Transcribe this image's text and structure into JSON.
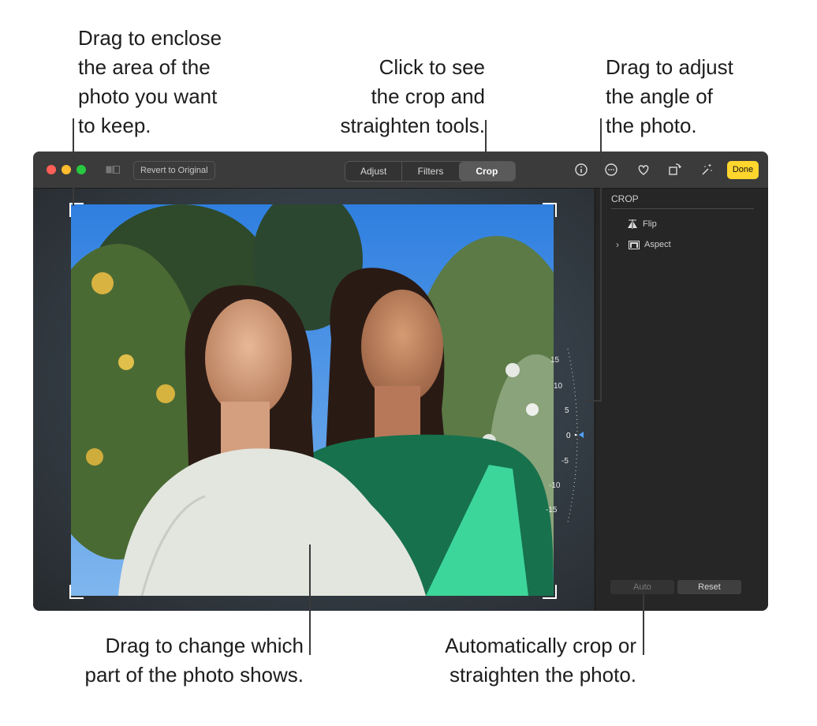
{
  "callouts": {
    "enclose": "Drag to enclose\nthe area of the\nphoto you want\nto keep.",
    "tools": "Click to see\nthe crop and\nstraighten tools.",
    "angle": "Drag to adjust\nthe angle of\nthe photo.",
    "move": "Drag to change which\npart of the photo shows.",
    "auto": "Automatically crop or\nstraighten the photo."
  },
  "toolbar": {
    "revert_label": "Revert to Original",
    "tabs": [
      "Adjust",
      "Filters",
      "Crop"
    ],
    "active_tab": "Crop",
    "done_label": "Done",
    "icons": [
      "compare-icon",
      "info-icon",
      "more-icon",
      "heart-icon",
      "rotate-icon",
      "magic-wand-icon"
    ]
  },
  "dial": {
    "ticks": [
      "15",
      "10",
      "5",
      "0",
      "-5",
      "-10",
      "-15"
    ],
    "current_angle": 0
  },
  "sidebar": {
    "heading": "CROP",
    "flip_label": "Flip",
    "aspect_label": "Aspect",
    "auto_label": "Auto",
    "reset_label": "Reset"
  },
  "colors": {
    "done_button": "#ffd52e",
    "dial_marker": "#4fa3ff",
    "traffic_red": "#ff5f57",
    "traffic_yellow": "#febc2e",
    "traffic_green": "#28c840"
  }
}
